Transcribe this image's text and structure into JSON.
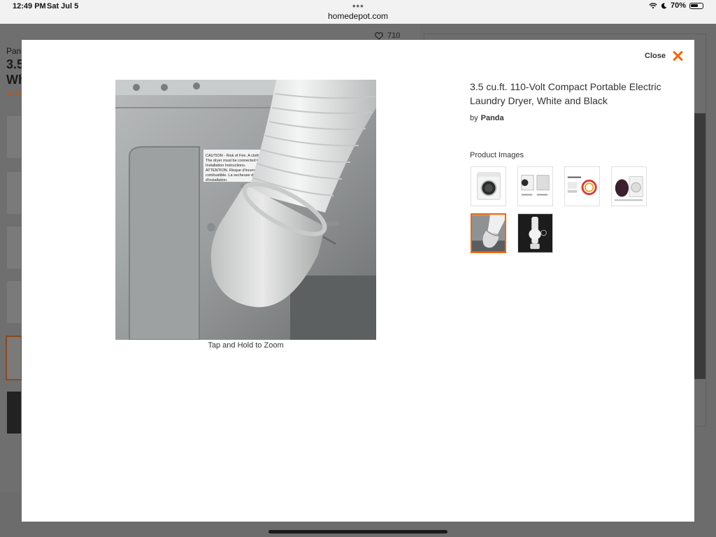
{
  "status_bar": {
    "time": "12:49 PM",
    "date": "Sat Jul 5",
    "url": "homedepot.com",
    "battery": "70%",
    "battery_level": 0.7
  },
  "background_page": {
    "brand": "Panda",
    "title_line1": "3.5",
    "title_line2": "Wh",
    "favorites_count": "710"
  },
  "modal": {
    "close_label": "Close",
    "zoom_hint": "Tap and Hold to Zoom",
    "product_title": "3.5 cu.ft. 110-Volt Compact Portable Electric Laundry Dryer, White and Black",
    "by_label": "by",
    "brand": "Panda",
    "thumbnails_label": "Product Images",
    "main_image_caution_text": [
      "CAUTION - Risk of Fire. A clothes dryer pro",
      "The dryer must be connected to an exh",
      "Installation Instructions.",
      "ATTENTION. Risque d'incendie",
      "combustible. La secheuse doit",
      "d'installation."
    ],
    "thumbnails": [
      {
        "name": "dryer-front",
        "active": false
      },
      {
        "name": "dryer-dimensions",
        "active": false
      },
      {
        "name": "panda-features",
        "active": false
      },
      {
        "name": "dryer-door-open",
        "active": false
      },
      {
        "name": "vent-hose-installed",
        "active": true
      },
      {
        "name": "vent-hose-kit",
        "active": false
      }
    ]
  },
  "colors": {
    "accent": "#f96302",
    "overlay": "#6f6f6f"
  }
}
